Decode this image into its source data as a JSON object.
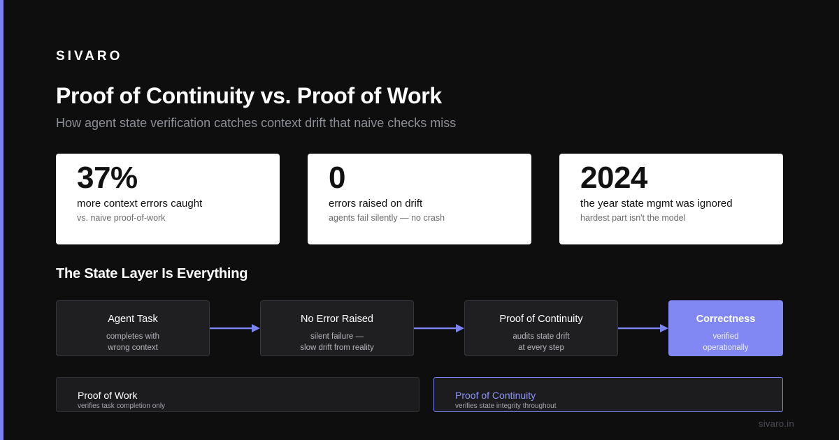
{
  "brand": "SIVARO",
  "title": "Proof of Continuity vs. Proof of Work",
  "subtitle": "How agent state verification catches context drift that naive checks miss",
  "stats": [
    {
      "value": "37%",
      "label": "more context errors caught",
      "note": "vs. naive proof-of-work"
    },
    {
      "value": "0",
      "label": "errors raised on drift",
      "note": "agents fail silently — no crash"
    },
    {
      "value": "2024",
      "label": "the year state mgmt was ignored",
      "note": "hardest part isn't the model"
    }
  ],
  "section_title": "The State Layer Is Everything",
  "flow": [
    {
      "title": "Agent Task",
      "desc_line1": "completes with",
      "desc_line2": "wrong context"
    },
    {
      "title": "No Error Raised",
      "desc_line1": "silent failure —",
      "desc_line2": "slow drift from reality"
    },
    {
      "title": "Proof of Continuity",
      "desc_line1": "audits state drift",
      "desc_line2": "at every step"
    },
    {
      "title": "Correctness",
      "desc_line1": "verified",
      "desc_line2": "operationally"
    }
  ],
  "compare": {
    "work": {
      "title": "Proof of Work",
      "desc": "verifies task completion only"
    },
    "continuity": {
      "title": "Proof of Continuity",
      "desc": "verifies state integrity throughout"
    }
  },
  "footer": "sivaro.in",
  "colors": {
    "accent": "#7b83f0",
    "background": "#0e0e0f",
    "card": "#ffffff"
  }
}
